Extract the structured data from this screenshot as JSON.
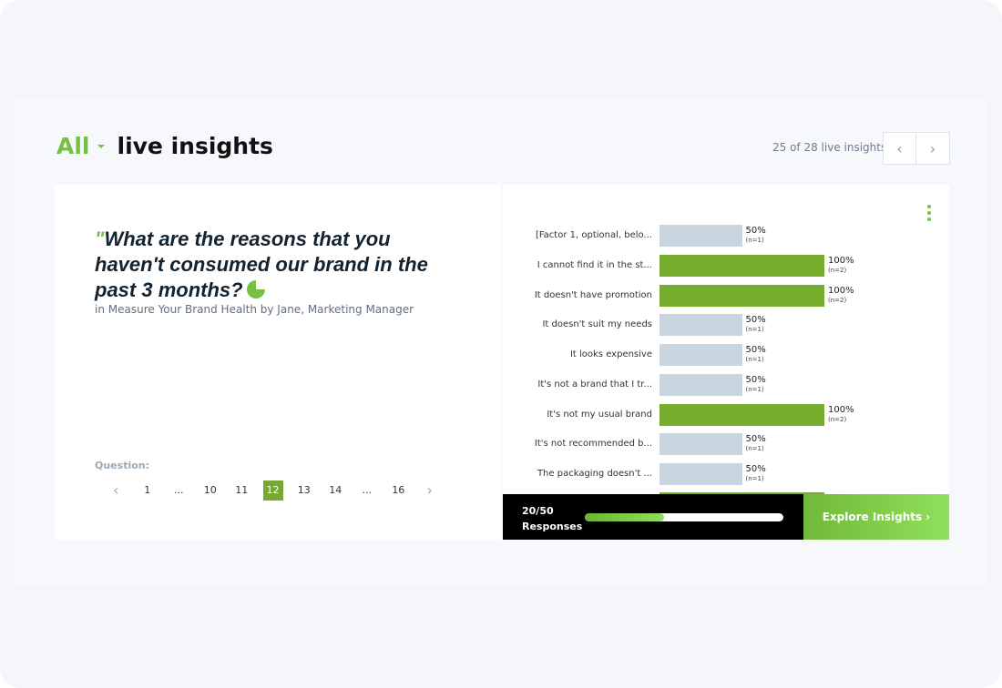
{
  "header": {
    "filter": "All",
    "title": "live insights",
    "counter": "25 of 28 live insights",
    "prev_icon": "chevron-left-icon",
    "next_icon": "chevron-right-icon"
  },
  "question": {
    "quote_mark": "\"",
    "text": "What are the reasons that you haven't consumed our brand in the past 3 months?",
    "subtitle": "in Measure Your Brand Health by Jane, Marketing Manager",
    "label": "Question:",
    "pages": [
      "1",
      "...",
      "10",
      "11",
      "12",
      "13",
      "14",
      "...",
      "16"
    ],
    "active_page": "12"
  },
  "colors": {
    "accent": "#76c043",
    "bar_highlight": "#76ad2f",
    "bar_default": "#c9d6e0"
  },
  "chart_data": {
    "type": "bar",
    "orientation": "horizontal",
    "categories": [
      "[Factor 1, optional, belo...",
      "I cannot find it in the st...",
      "It doesn't have promotion",
      "It doesn't suit my needs",
      "It looks expensive",
      "It's not a brand that I tr...",
      "It's not my usual brand",
      "It's not recommended b...",
      "The packaging doesn't ..."
    ],
    "values": [
      50,
      100,
      100,
      50,
      50,
      50,
      100,
      50,
      50
    ],
    "labels": [
      "50%",
      "100%",
      "100%",
      "50%",
      "50%",
      "50%",
      "100%",
      "50%",
      "50%"
    ],
    "counts": [
      "(n=1)",
      "(n=2)",
      "(n=2)",
      "(n=1)",
      "(n=1)",
      "(n=1)",
      "(n=2)",
      "(n=1)",
      "(n=1)"
    ],
    "xlim": [
      0,
      100
    ]
  },
  "footer": {
    "responses_count": "20/50",
    "responses_label": "Responses",
    "progress": 0.4,
    "explore": "Explore Insights ›"
  }
}
